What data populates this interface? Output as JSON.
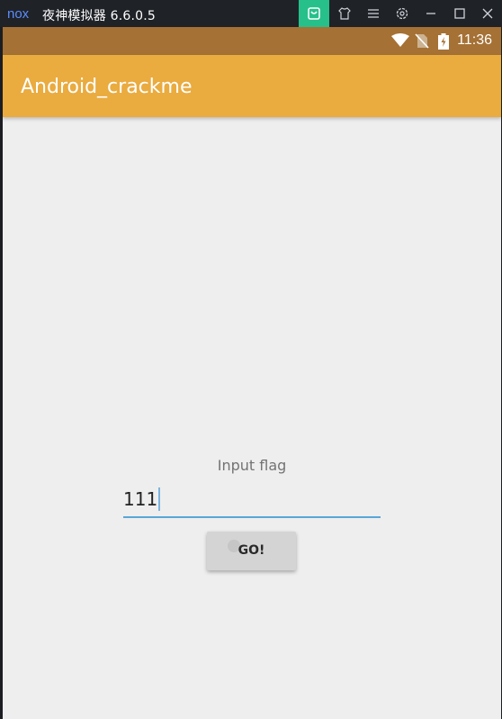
{
  "window": {
    "logo_text": "nox",
    "title": "夜神模拟器 6.6.0.5",
    "buttons": [
      "app-store-icon",
      "skin-icon",
      "menu-icon",
      "settings-icon",
      "minimize-icon",
      "maximize-icon",
      "close-icon"
    ]
  },
  "colors": {
    "titlebar": "#1f2227",
    "app_store_accent": "#27c08b",
    "status_bar": "#a57135",
    "app_bar": "#eaab3f",
    "background": "#eeeeee",
    "input_underline": "#5aa6d8",
    "button": "#d4d4d4"
  },
  "status_bar": {
    "time": "11:36",
    "icons": [
      "wifi-icon",
      "no-sim-icon",
      "battery-icon"
    ]
  },
  "app_bar": {
    "title": "Android_crackme"
  },
  "form": {
    "label": "Input flag",
    "input_value": "111",
    "button_label": "GO!"
  }
}
